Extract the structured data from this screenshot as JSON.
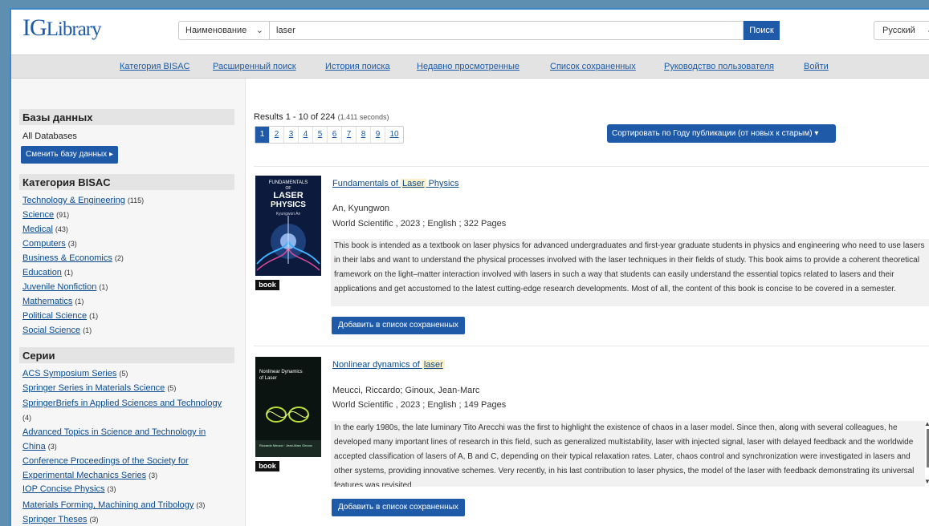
{
  "header": {
    "logo_ig": "IG",
    "logo_library": "Library",
    "search_type": "Наименование",
    "search_value": "laser",
    "search_button": "Поиск",
    "language": "Русский"
  },
  "nav": [
    "Категория BISAC",
    "Расширенный поиск",
    "История поиска",
    "Недавно просмотренные",
    "Список сохраненных",
    "Руководство пользователя",
    "Войти"
  ],
  "sidebar": {
    "databases_title": "Базы данных",
    "databases_value": "All Databases",
    "change_db_button": "Сменить базу данных ▸",
    "bisac_title": "Категория BISAC",
    "bisac": [
      {
        "label": "Technology & Engineering",
        "count": "(115)"
      },
      {
        "label": "Science",
        "count": "(91)"
      },
      {
        "label": "Medical",
        "count": "(43)"
      },
      {
        "label": "Computers",
        "count": "(3)"
      },
      {
        "label": "Business & Economics",
        "count": "(2)"
      },
      {
        "label": "Education",
        "count": "(1)"
      },
      {
        "label": "Juvenile Nonfiction",
        "count": "(1)"
      },
      {
        "label": "Mathematics",
        "count": "(1)"
      },
      {
        "label": "Political Science",
        "count": "(1)"
      },
      {
        "label": "Social Science",
        "count": "(1)"
      }
    ],
    "series_title": "Серии",
    "series": [
      {
        "label": "ACS Symposium Series",
        "count": "(5)"
      },
      {
        "label": "Springer Series in Materials Science",
        "count": "(5)"
      },
      {
        "label": "SpringerBriefs in Applied Sciences and Technology",
        "count": "(4)"
      },
      {
        "label": "Advanced Topics in Science and Technology in China",
        "count": "(3)"
      },
      {
        "label": "Conference Proceedings of the Society for Experimental Mechanics Series",
        "count": "(3)"
      },
      {
        "label": "IOP Concise Physics",
        "count": "(3)"
      },
      {
        "label": "Materials Forming, Machining and Tribology",
        "count": "(3)"
      },
      {
        "label": "Springer Theses",
        "count": "(3)"
      }
    ]
  },
  "results": {
    "summary": "Results 1 - 10 of 224",
    "seconds": "(1.411 seconds)",
    "pages": [
      "1",
      "2",
      "3",
      "4",
      "5",
      "6",
      "7",
      "8",
      "9",
      "10"
    ],
    "sort_button": "Сортировать по Году публикации (от новых к старым) ▾",
    "items": [
      {
        "title_before": "Fundamentals of ",
        "title_highlight": "Laser",
        "title_after": " Physics",
        "author": "An, Kyungwon",
        "publication": "World Scientific , 2023 ; English ; 322 Pages",
        "description": "This book is intended as a textbook on laser physics for advanced undergraduates and first-year graduate students in physics and engineering who need to use lasers in their labs and want to understand the physical processes involved with the laser techniques in their fields of study. This book aims to provide a coherent theoretical framework on the light–matter interaction involved with lasers in such a way that students can easily understand the essential topics related to lasers and their applications and get accustomed to the latest cutting-edge research developments. Most of all, the content of this book is concise to be covered in a semester.",
        "type_tag": "book",
        "save_button": "Добавить в список сохраненных",
        "cover_line1": "FUNDAMENTALS",
        "cover_line2": "OF",
        "cover_line3": "LASER",
        "cover_line4": "PHYSICS",
        "cover_author": "Kyungwon An"
      },
      {
        "title_before": "Nonlinear dynamics of ",
        "title_highlight": "laser",
        "title_after": "",
        "author": "Meucci, Riccardo; Ginoux, Jean-Marc",
        "publication": "World Scientific , 2023 ; English ; 149 Pages",
        "description": "In the early 1980s, the late luminary Tito Arecchi was the first to highlight the existence of chaos in a laser model. Since then, along with several colleagues, he developed many important lines of research in this field, such as generalized multistability, laser with injected signal, laser with delayed feedback and the worldwide accepted classification of lasers of A, B and C, depending on their typical relaxation rates. Later, chaos control and synchronization were investigated in lasers and other systems, providing innovative schemes. Very recently, in his last contribution to laser physics, the model of the laser with feedback demonstrating its universal features was revisited.",
        "type_tag": "book",
        "save_button": "Добавить в список сохраненных",
        "cover_line1": "Nonlinear Dynamics",
        "cover_line2": "of Laser",
        "cover_line3": "",
        "cover_line4": "",
        "cover_author": "Riccardo Meucci · Jean-Marc Ginoux"
      }
    ]
  }
}
